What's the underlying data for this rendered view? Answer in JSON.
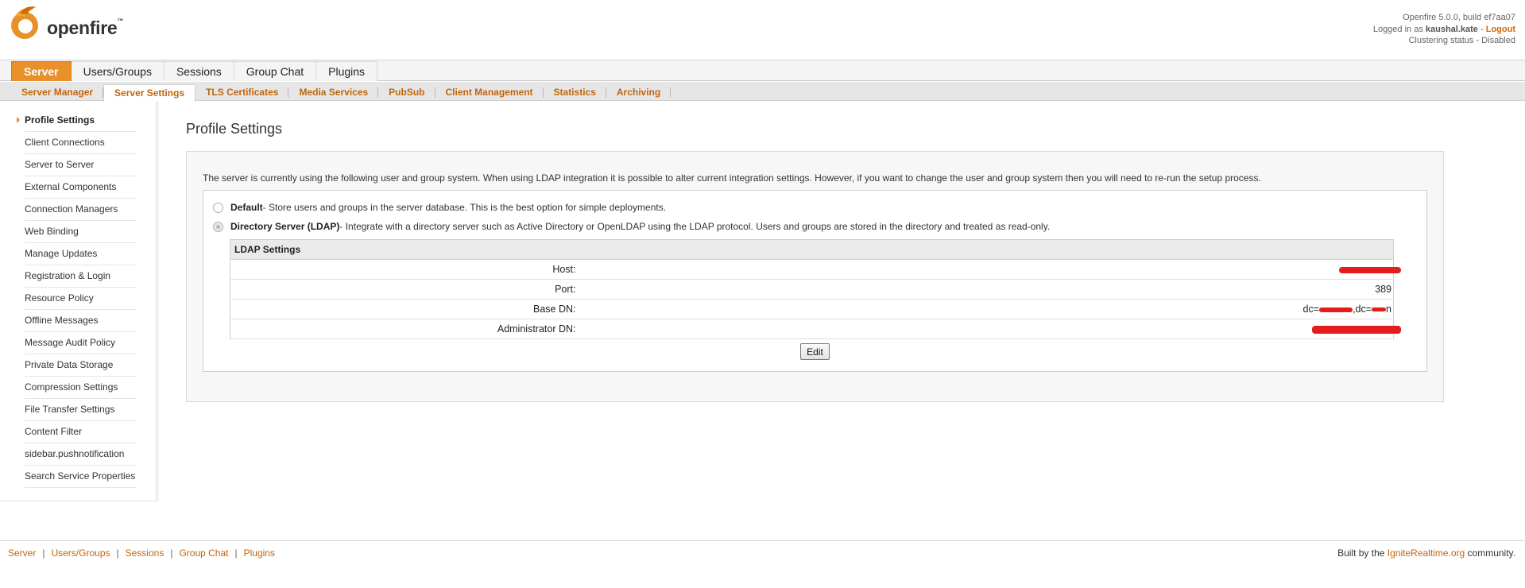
{
  "header": {
    "logo_text": "openfire",
    "logo_tm": "™",
    "version": "Openfire 5.0.0, build ef7aa07",
    "logged_in_prefix": "Logged in as",
    "username": "kaushal.kate",
    "logout_sep": "-",
    "logout_label": "Logout",
    "clustering_status": "Clustering status - Disabled"
  },
  "main_tabs": [
    {
      "label": "Server",
      "active": true
    },
    {
      "label": "Users/Groups"
    },
    {
      "label": "Sessions"
    },
    {
      "label": "Group Chat"
    },
    {
      "label": "Plugins"
    }
  ],
  "sub_tabs": [
    {
      "label": "Server Manager"
    },
    {
      "label": "Server Settings",
      "active": true
    },
    {
      "label": "TLS Certificates"
    },
    {
      "label": "Media Services"
    },
    {
      "label": "PubSub"
    },
    {
      "label": "Client Management"
    },
    {
      "label": "Statistics"
    },
    {
      "label": "Archiving"
    }
  ],
  "sidebar": {
    "items": [
      {
        "label": "Profile Settings",
        "active": true
      },
      {
        "label": "Client Connections"
      },
      {
        "label": "Server to Server"
      },
      {
        "label": "External Components"
      },
      {
        "label": "Connection Managers"
      },
      {
        "label": "Web Binding"
      },
      {
        "label": "Manage Updates"
      },
      {
        "label": "Registration & Login"
      },
      {
        "label": "Resource Policy"
      },
      {
        "label": "Offline Messages"
      },
      {
        "label": "Message Audit Policy"
      },
      {
        "label": "Private Data Storage"
      },
      {
        "label": "Compression Settings"
      },
      {
        "label": "File Transfer Settings"
      },
      {
        "label": "Content Filter"
      },
      {
        "label": "sidebar.pushnotification"
      },
      {
        "label": "Search Service Properties"
      }
    ]
  },
  "main": {
    "title": "Profile Settings",
    "description": "The server is currently using the following user and group system. When using LDAP integration it is possible to alter current integration settings. However, if you want to change the user and group system then you will need to re-run the setup process.",
    "default_option": {
      "label": "Default",
      "text": " - Store users and groups in the server database. This is the best option for simple deployments."
    },
    "ldap_option": {
      "label": "Directory Server (LDAP)",
      "text": " - Integrate with a directory server such as Active Directory or OpenLDAP using the LDAP protocol. Users and groups are stored in the directory and treated as read-only."
    },
    "ldap_table": {
      "heading": "LDAP Settings",
      "rows": [
        {
          "label": "Host:",
          "value": ""
        },
        {
          "label": "Port:",
          "value": "389"
        },
        {
          "label": "Base DN:",
          "value_prefix": "dc=",
          "value_mid": ",dc=",
          "value_suffix": "n"
        },
        {
          "label": "Administrator DN:",
          "value": ""
        }
      ]
    },
    "edit_label": "Edit"
  },
  "footer": {
    "links": [
      "Server",
      "Users/Groups",
      "Sessions",
      "Group Chat",
      "Plugins"
    ],
    "separator": "|",
    "credit_prefix": "Built by the",
    "credit_link": "IgniteRealtime.org",
    "credit_suffix": "community."
  },
  "colors": {
    "accent": "#e9902a",
    "link": "#c2650c",
    "redaction": "#e41c1c"
  }
}
